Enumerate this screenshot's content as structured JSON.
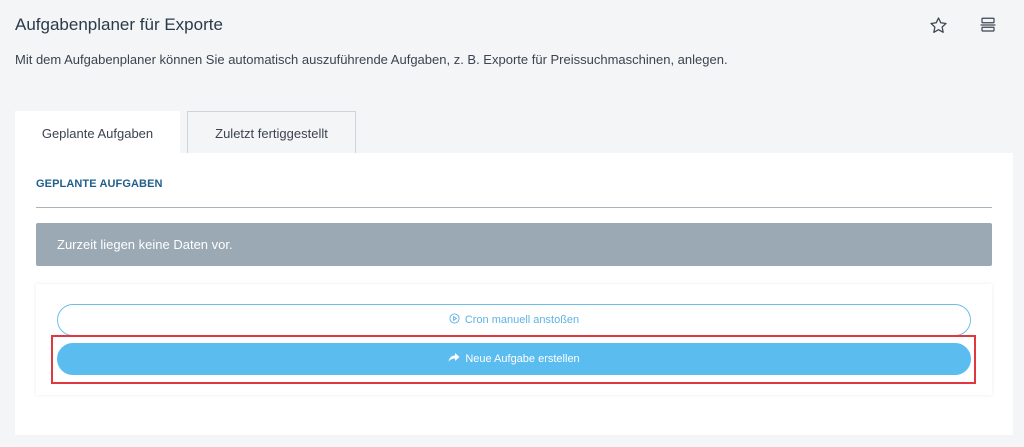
{
  "header": {
    "title": "Aufgabenplaner für Exporte",
    "description": "Mit dem Aufgabenplaner können Sie automatisch auszuführende Aufgaben, z. B. Exporte für Preissuchmaschinen, anlegen.",
    "icons": [
      "star-icon",
      "layout-icon"
    ]
  },
  "tabs": [
    {
      "label": "Geplante Aufgaben",
      "active": true
    },
    {
      "label": "Zuletzt fertiggestellt",
      "active": false
    }
  ],
  "panel": {
    "section_heading": "GEPLANTE AUFGABEN",
    "empty_message": "Zurzeit liegen keine Daten vor.",
    "cron_button": {
      "label": "Cron manuell anstoßen",
      "icon": "play-circle-icon"
    },
    "new_task_button": {
      "label": "Neue Aufgabe erstellen",
      "icon": "share-arrow-icon"
    }
  },
  "colors": {
    "accent": "#5bbcf0",
    "alert_bg": "#9aa9b4",
    "highlight": "#e0383e",
    "heading": "#1f5f8b"
  }
}
